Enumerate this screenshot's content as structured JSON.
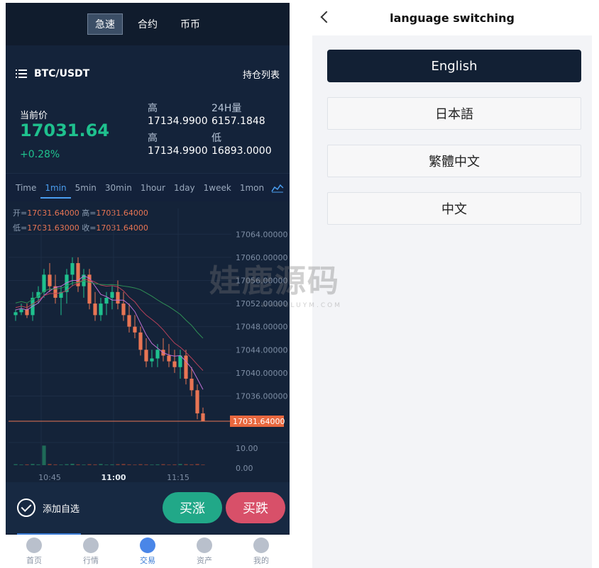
{
  "top_tabs": [
    {
      "label": "急速",
      "active": true
    },
    {
      "label": "合约",
      "active": false
    },
    {
      "label": "币币",
      "active": false
    }
  ],
  "pair": {
    "name": "BTC/USDT",
    "positions_label": "持仓列表"
  },
  "price": {
    "current_label": "当前价",
    "current_value": "17031.64",
    "change": "+0.28%",
    "high_label": "高",
    "high_value": "17134.9900",
    "vol_label": "24H量",
    "vol_value": "6157.1848",
    "high2_label": "高",
    "high2_value": "17134.9900",
    "low_label": "低",
    "low_value": "16893.0000"
  },
  "periods": [
    {
      "label": "Time",
      "active": false
    },
    {
      "label": "1min",
      "active": true
    },
    {
      "label": "5min",
      "active": false
    },
    {
      "label": "30min",
      "active": false
    },
    {
      "label": "1hour",
      "active": false
    },
    {
      "label": "1day",
      "active": false
    },
    {
      "label": "1week",
      "active": false
    },
    {
      "label": "1mon",
      "active": false
    }
  ],
  "ohlc": {
    "open_label": "开=",
    "open": "17031.64000",
    "high_label": "高=",
    "high": "17031.64000",
    "low_label": "低=",
    "low": "17031.63000",
    "close_label": "收=",
    "close": "17031.64000"
  },
  "chart_data": {
    "type": "candlestick",
    "price_ticks": [
      "17064.00000",
      "17060.00000",
      "17056.00000",
      "17052.00000",
      "17048.00000",
      "17044.00000",
      "17040.00000",
      "17036.00000"
    ],
    "last_price_label": "17031.64000",
    "volume_ticks": [
      "10.00",
      "0.00"
    ],
    "time_ticks": [
      "10:45",
      "11:00",
      "11:15"
    ],
    "ylim": [
      17031.64,
      17064
    ],
    "candles": [
      [
        17050,
        17051,
        17049,
        17050.5
      ],
      [
        17050.5,
        17052,
        17050,
        17051
      ],
      [
        17051,
        17052,
        17049.5,
        17050
      ],
      [
        17050,
        17054,
        17049,
        17053
      ],
      [
        17053,
        17055,
        17052,
        17054
      ],
      [
        17054,
        17058,
        17053,
        17057
      ],
      [
        17057,
        17059,
        17054,
        17055
      ],
      [
        17055,
        17057,
        17052,
        17053
      ],
      [
        17053,
        17055,
        17050,
        17054
      ],
      [
        17054,
        17058,
        17052,
        17057
      ],
      [
        17057,
        17060,
        17055,
        17059
      ],
      [
        17059,
        17060,
        17054,
        17055
      ],
      [
        17055,
        17058,
        17053,
        17057
      ],
      [
        17057,
        17058,
        17051,
        17052
      ],
      [
        17052,
        17054,
        17049,
        17050
      ],
      [
        17050,
        17053,
        17049,
        17052
      ],
      [
        17052,
        17054,
        17050,
        17053
      ],
      [
        17053,
        17055,
        17051,
        17054
      ],
      [
        17054,
        17056,
        17051,
        17052
      ],
      [
        17052,
        17054,
        17049,
        17050
      ],
      [
        17050,
        17052,
        17047,
        17048
      ],
      [
        17048,
        17050,
        17046,
        17047
      ],
      [
        17047,
        17048,
        17043,
        17044
      ],
      [
        17044,
        17046,
        17041,
        17042
      ],
      [
        17042,
        17044,
        17041,
        17042.5
      ],
      [
        17042.5,
        17045,
        17041,
        17044
      ],
      [
        17044,
        17046,
        17042,
        17043
      ],
      [
        17043,
        17045,
        17041,
        17042
      ],
      [
        17042,
        17044,
        17040,
        17041
      ],
      [
        17041,
        17044,
        17039,
        17043
      ],
      [
        17043,
        17044,
        17038,
        17039
      ],
      [
        17039,
        17041,
        17036,
        17037
      ],
      [
        17037,
        17038,
        17032,
        17033
      ],
      [
        17033,
        17034,
        17031.6,
        17031.64
      ]
    ],
    "volumes": [
      0.5,
      0.3,
      0.4,
      0.6,
      0.4,
      9.5,
      0.6,
      0.4,
      0.3,
      0.5,
      0.7,
      0.4,
      0.3,
      0.5,
      0.4,
      0.6,
      0.3,
      0.4,
      0.5,
      0.6,
      0.4,
      0.3,
      0.5,
      0.4,
      0.3,
      0.4,
      0.5,
      0.3,
      0.4,
      0.6,
      0.5,
      0.4,
      0.6,
      0.3
    ],
    "volume_max": 11
  },
  "bottom": {
    "fav_label": "添加自选",
    "up_label": "买涨",
    "down_label": "买跌"
  },
  "nav": [
    {
      "label": "首页",
      "icon": "home-icon",
      "active": false
    },
    {
      "label": "行情",
      "icon": "market-icon",
      "active": false
    },
    {
      "label": "交易",
      "icon": "trade-icon",
      "active": true
    },
    {
      "label": "资产",
      "icon": "wallet-icon",
      "active": false
    },
    {
      "label": "我的",
      "icon": "user-icon",
      "active": false
    }
  ],
  "language_panel": {
    "title": "language switching",
    "options": [
      {
        "label": "English",
        "active": true
      },
      {
        "label": "日本語",
        "active": false
      },
      {
        "label": "繁體中文",
        "active": false
      },
      {
        "label": "中文",
        "active": false
      }
    ]
  },
  "watermark": {
    "text": "娃鹿源码",
    "sub": "WAWULUYM.COM"
  },
  "colors": {
    "up": "#1fc18e",
    "down": "#e87554",
    "panel": "#14233a",
    "accent": "#4b9ef0"
  }
}
